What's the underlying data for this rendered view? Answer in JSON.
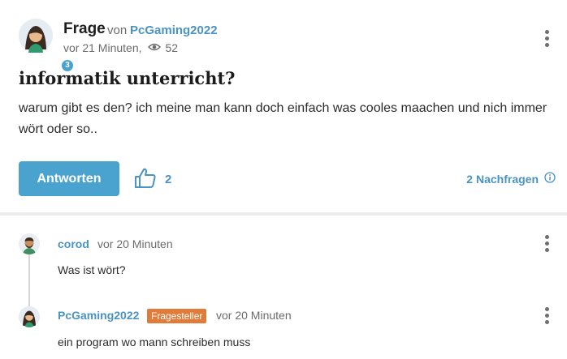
{
  "question": {
    "type_label": "Frage",
    "von_label": "von",
    "author": "PcGaming2022",
    "author_level": "3",
    "time": "vor 21 Minuten,",
    "views": "52",
    "title": "informatik unterricht?",
    "body": "warum gibt es den? ich meine man kann doch einfach was cooles maachen und nich immer wört oder so.."
  },
  "actions": {
    "answer_label": "Antworten",
    "like_count": "2",
    "nachfragen_label": "2 Nachfragen"
  },
  "comments": [
    {
      "author": "corod",
      "time": "vor 20 Minuten",
      "text": "Was ist wört?"
    },
    {
      "author": "PcGaming2022",
      "badge": "Fragesteller",
      "time": "vor 20 Minuten",
      "text": "ein program wo mann schreiben muss"
    }
  ],
  "icons": {
    "views": "eye-icon",
    "like": "thumbs-up-icon",
    "info": "info-icon",
    "more": "more-vertical-icon"
  },
  "colors": {
    "accent": "#4aa3cf",
    "link": "#4a93c2",
    "asker_badge": "#e07b39"
  }
}
